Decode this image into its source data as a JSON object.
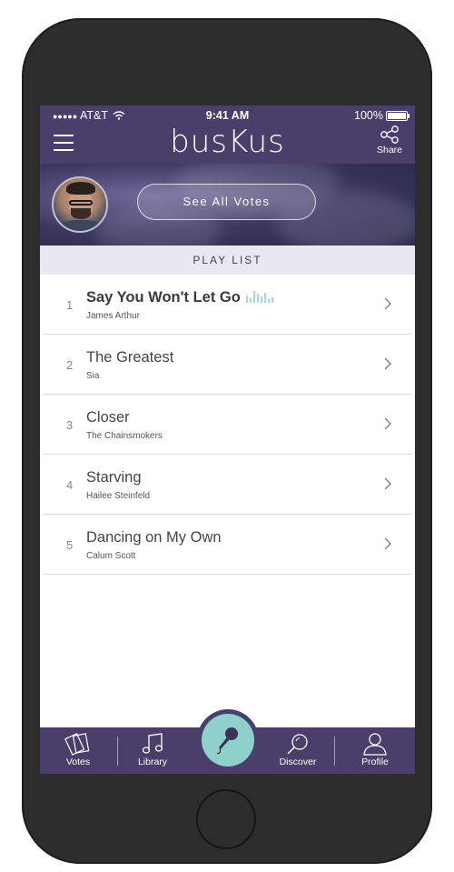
{
  "status_bar": {
    "carrier": "AT&T",
    "signal_dots": "●●●●●",
    "time": "9:41 AM",
    "battery": "100%"
  },
  "header": {
    "logo": "busKus",
    "share_label": "Share"
  },
  "banner": {
    "votes_button": "See All Votes"
  },
  "playlist": {
    "header": "PLAY LIST",
    "items": [
      {
        "num": "1",
        "title": "Say You Won't Let Go",
        "artist": "James Arthur",
        "now_playing": true
      },
      {
        "num": "2",
        "title": "The Greatest",
        "artist": "Sia"
      },
      {
        "num": "3",
        "title": "Closer",
        "artist": "The Chainsmokers"
      },
      {
        "num": "4",
        "title": "Starving",
        "artist": "Hailee Steinfeld"
      },
      {
        "num": "5",
        "title": "Dancing on My Own",
        "artist": "Calum Scott"
      }
    ]
  },
  "tabbar": {
    "votes": "Votes",
    "library": "Library",
    "discover": "Discover",
    "profile": "Profile"
  },
  "colors": {
    "brand_purple": "#4a3f6b",
    "accent_teal": "#8fd0cb",
    "playlist_header_bg": "#e9e7f2"
  },
  "icons": [
    "menu-icon",
    "share-icon",
    "chevron-right-icon",
    "equalizer-icon",
    "votes-cards-icon",
    "library-music-icon",
    "microphone-icon",
    "discover-search-icon",
    "profile-person-icon",
    "battery-icon",
    "wifi-icon"
  ]
}
